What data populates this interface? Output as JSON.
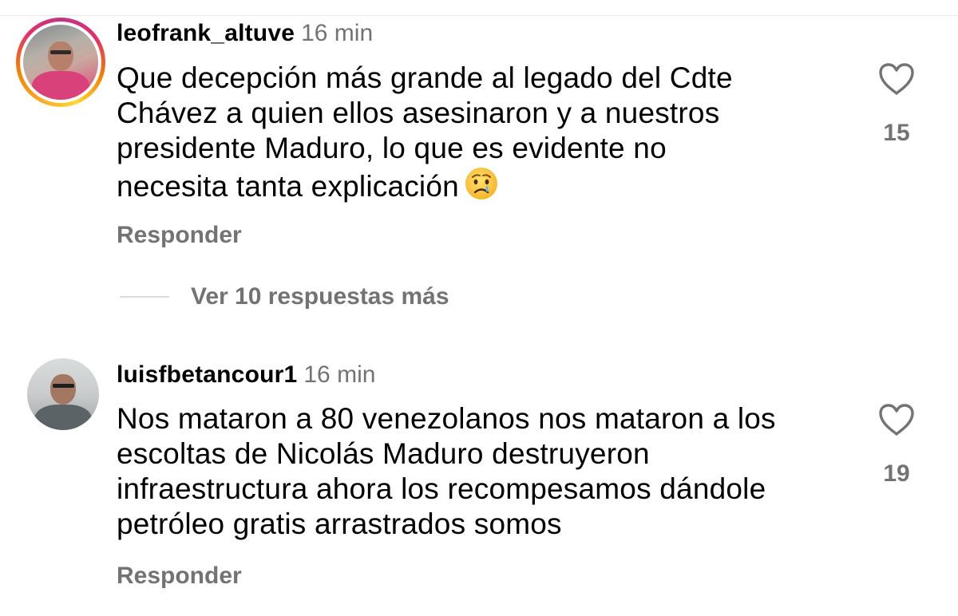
{
  "comments": [
    {
      "username": "leofrank_altuve",
      "time": "16 min",
      "lines": [
        "Que decepción más grande al legado del Cdte",
        "Chávez a quien ellos asesinaron y a nuestros",
        "presidente Maduro,  lo que es evidente no",
        "necesita tanta explicación"
      ],
      "emoji": "crying-face",
      "reply_label": "Responder",
      "like_count": "15",
      "has_story_ring": true
    },
    {
      "username": "luisfbetancour1",
      "time": "16 min",
      "lines": [
        "Nos mataron a 80 venezolanos nos mataron a los",
        "escoltas de Nicolás Maduro destruyeron",
        "infraestructura ahora los recompesamos dándole",
        "petróleo gratis arrastrados somos"
      ],
      "reply_label": "Responder",
      "like_count": "19",
      "has_story_ring": false
    }
  ],
  "view_more_replies": "Ver 10 respuestas más",
  "colors": {
    "secondary_text": "#737373",
    "primary_text": "#000000",
    "background": "#ffffff",
    "divider": "#dbdbdb"
  }
}
